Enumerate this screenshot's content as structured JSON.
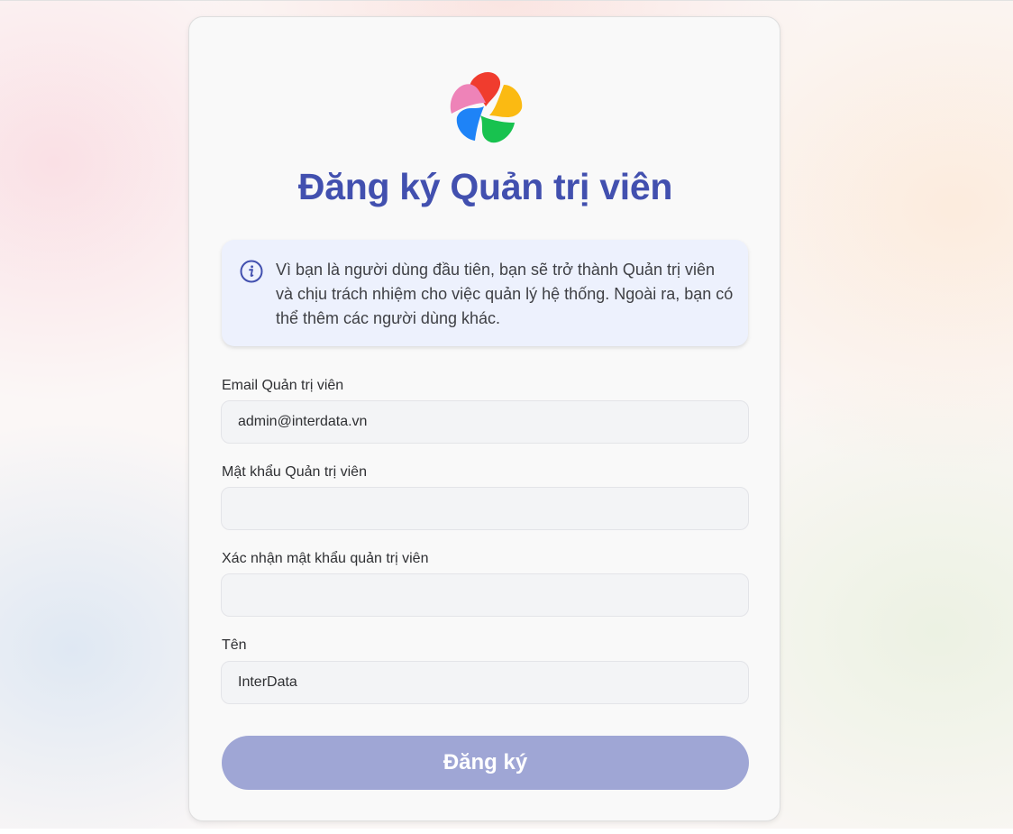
{
  "header": {
    "logo_icon": "photo-flower-logo-icon",
    "title": "Đăng ký Quản trị viên"
  },
  "notice": {
    "icon": "info-icon",
    "text": "Vì bạn là người dùng đầu tiên, bạn sẽ trở thành Quản trị viên và chịu trách nhiệm cho việc quản lý hệ thống. Ngoài ra, bạn có thể thêm các người dùng khác."
  },
  "form": {
    "email": {
      "label": "Email Quản trị viên",
      "value": "admin@interdata.vn"
    },
    "password": {
      "label": "Mật khẩu Quản trị viên",
      "value": ""
    },
    "confirm_password": {
      "label": "Xác nhận mật khẩu quản trị viên",
      "value": ""
    },
    "name": {
      "label": "Tên",
      "value": "InterData"
    },
    "submit_label": "Đăng ký"
  },
  "colors": {
    "title": "#4250af",
    "notice_bg": "#edf1fd",
    "button_bg": "#9fa6d5",
    "logo_red": "#f03c2e",
    "logo_yellow": "#fbba12",
    "logo_green": "#18c24f",
    "logo_blue": "#1e83f7",
    "logo_pink": "#ee83b8"
  }
}
